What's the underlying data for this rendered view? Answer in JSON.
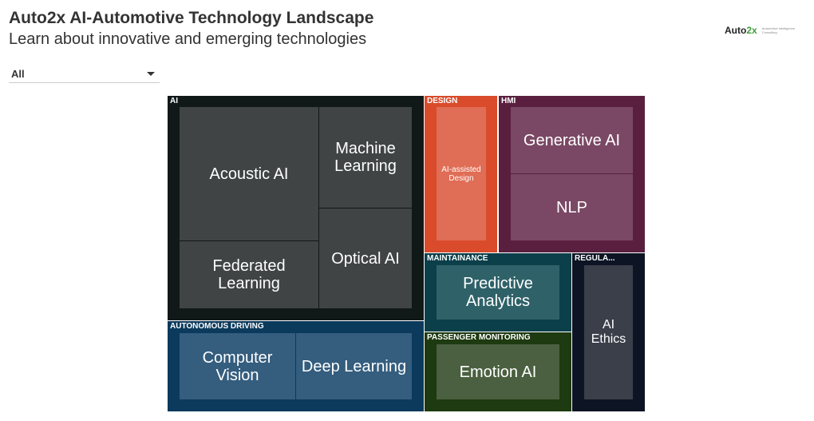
{
  "header": {
    "title": "Auto2x AI-Automotive Technology Landscape",
    "subtitle": "Learn about innovative and emerging technologies"
  },
  "logo": {
    "brand": "Auto2x",
    "tagline": "Automotive Intelligence Consulting"
  },
  "filter": {
    "selected": "All"
  },
  "treemap": {
    "groups": [
      {
        "label": "AI",
        "color": "#111818",
        "tile_color": "#404444",
        "items": [
          "Acoustic AI",
          "Machine Learning",
          "Optical AI",
          "Federated Learning"
        ]
      },
      {
        "label": "DESIGN",
        "color": "#d94b2b",
        "tile_color": "#e06d55",
        "items": [
          "AI-assisted Design"
        ]
      },
      {
        "label": "HMI",
        "color": "#5a1f3f",
        "tile_color": "#7a4864",
        "items": [
          "Generative AI",
          "NLP"
        ]
      },
      {
        "label": "AUTONOMOUS DRIVING",
        "color": "#0b3a5c",
        "tile_color": "#345d7e",
        "items": [
          "Computer Vision",
          "Deep Learning"
        ]
      },
      {
        "label": "MAINTAINANCE",
        "color": "#0b3f4a",
        "tile_color": "#2f6168",
        "items": [
          "Predictive Analytics"
        ]
      },
      {
        "label": "PASSENGER MONITORING",
        "color": "#1d3a10",
        "tile_color": "#4a6040",
        "items": [
          "Emotion AI"
        ]
      },
      {
        "label": "REGULA...",
        "color": "#0d1424",
        "tile_color": "#3a3f4a",
        "items": [
          "AI Ethics"
        ]
      }
    ]
  }
}
